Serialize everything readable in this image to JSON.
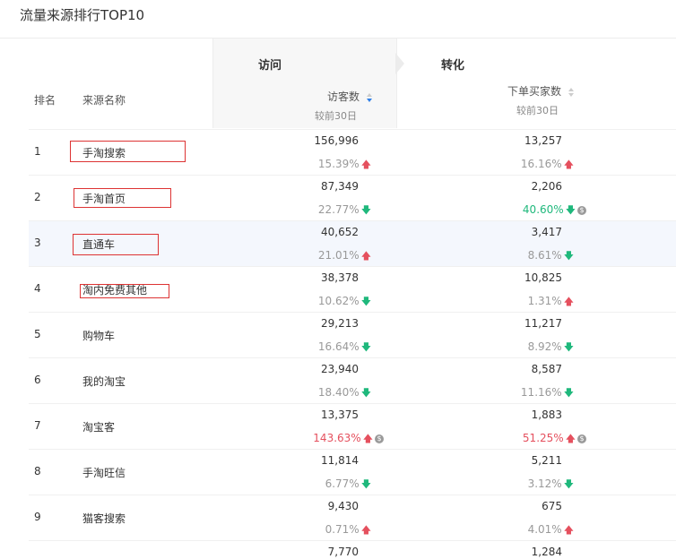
{
  "title": "流量来源排行TOP10",
  "header": {
    "rank_label": "排名",
    "name_label": "来源名称",
    "group_visit": "访问",
    "group_convert": "转化",
    "col_visitors": "访客数",
    "col_buyers": "下单买家数",
    "compare_label": "较前30日"
  },
  "rows": [
    {
      "rank": "1",
      "name": "手淘搜索",
      "visitors": "156,996",
      "visitors_rate": "15.39%",
      "visitors_dir": "up",
      "buyers": "13,257",
      "buyers_rate": "16.16%",
      "buyers_dir": "up"
    },
    {
      "rank": "2",
      "name": "手淘首页",
      "visitors": "87,349",
      "visitors_rate": "22.77%",
      "visitors_dir": "down",
      "buyers": "2,206",
      "buyers_rate": "40.60%",
      "buyers_dir": "down"
    },
    {
      "rank": "3",
      "name": "直通车",
      "visitors": "40,652",
      "visitors_rate": "21.01%",
      "visitors_dir": "up",
      "buyers": "3,417",
      "buyers_rate": "8.61%",
      "buyers_dir": "down"
    },
    {
      "rank": "4",
      "name": "淘内免费其他",
      "visitors": "38,378",
      "visitors_rate": "10.62%",
      "visitors_dir": "down",
      "buyers": "10,825",
      "buyers_rate": "1.31%",
      "buyers_dir": "up"
    },
    {
      "rank": "5",
      "name": "购物车",
      "visitors": "29,213",
      "visitors_rate": "16.64%",
      "visitors_dir": "down",
      "buyers": "11,217",
      "buyers_rate": "8.92%",
      "buyers_dir": "down"
    },
    {
      "rank": "6",
      "name": "我的淘宝",
      "visitors": "23,940",
      "visitors_rate": "18.40%",
      "visitors_dir": "down",
      "buyers": "8,587",
      "buyers_rate": "11.16%",
      "buyers_dir": "down"
    },
    {
      "rank": "7",
      "name": "淘宝客",
      "visitors": "13,375",
      "visitors_rate": "143.63%",
      "visitors_dir": "up",
      "buyers": "1,883",
      "buyers_rate": "51.25%",
      "buyers_dir": "up"
    },
    {
      "rank": "8",
      "name": "手淘旺信",
      "visitors": "11,814",
      "visitors_rate": "6.77%",
      "visitors_dir": "down",
      "buyers": "5,211",
      "buyers_rate": "3.12%",
      "buyers_dir": "down"
    },
    {
      "rank": "9",
      "name": "猫客搜索",
      "visitors": "9,430",
      "visitors_rate": "0.71%",
      "visitors_dir": "up",
      "buyers": "675",
      "buyers_rate": "4.01%",
      "buyers_dir": "up"
    },
    {
      "rank": "",
      "name": "",
      "visitors": "7,770",
      "visitors_rate": "",
      "visitors_dir": "",
      "buyers": "1,284",
      "buyers_rate": "",
      "buyers_dir": ""
    }
  ],
  "colors": {
    "up": "#e5505e",
    "down": "#1fb87c",
    "highlight_row": "#f4f7fd",
    "annotation_box": "#d33333",
    "sort_active": "#2f7fe8"
  }
}
